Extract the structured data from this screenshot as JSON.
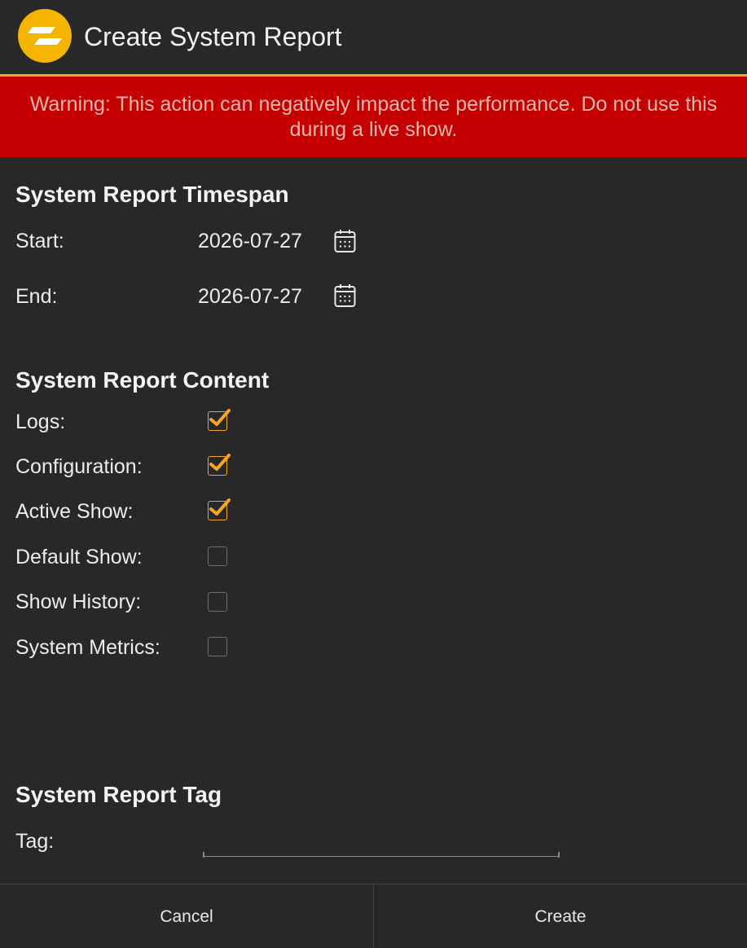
{
  "header": {
    "title": "Create System Report",
    "logo_icon": "app-logo-icon"
  },
  "colors": {
    "accent": "#f5a623",
    "warning_bg": "#c40000",
    "background": "#282828"
  },
  "warning": {
    "text": "Warning: This action can negatively impact the performance. Do not use this during a live show."
  },
  "timespan": {
    "title": "System Report Timespan",
    "start_label": "Start:",
    "start_value": "2026-07-27",
    "end_label": "End:",
    "end_value": "2026-07-27",
    "calendar_icon": "calendar-icon"
  },
  "content": {
    "title": "System Report Content",
    "items": [
      {
        "label": "Logs:",
        "checked": true
      },
      {
        "label": "Configuration:",
        "checked": true
      },
      {
        "label": "Active Show:",
        "checked": true
      },
      {
        "label": "Default Show:",
        "checked": false
      },
      {
        "label": "Show History:",
        "checked": false
      },
      {
        "label": "System Metrics:",
        "checked": false
      }
    ]
  },
  "tag": {
    "title": "System Report Tag",
    "label": "Tag:",
    "value": "",
    "placeholder": ""
  },
  "footer": {
    "cancel_label": "Cancel",
    "create_label": "Create"
  }
}
